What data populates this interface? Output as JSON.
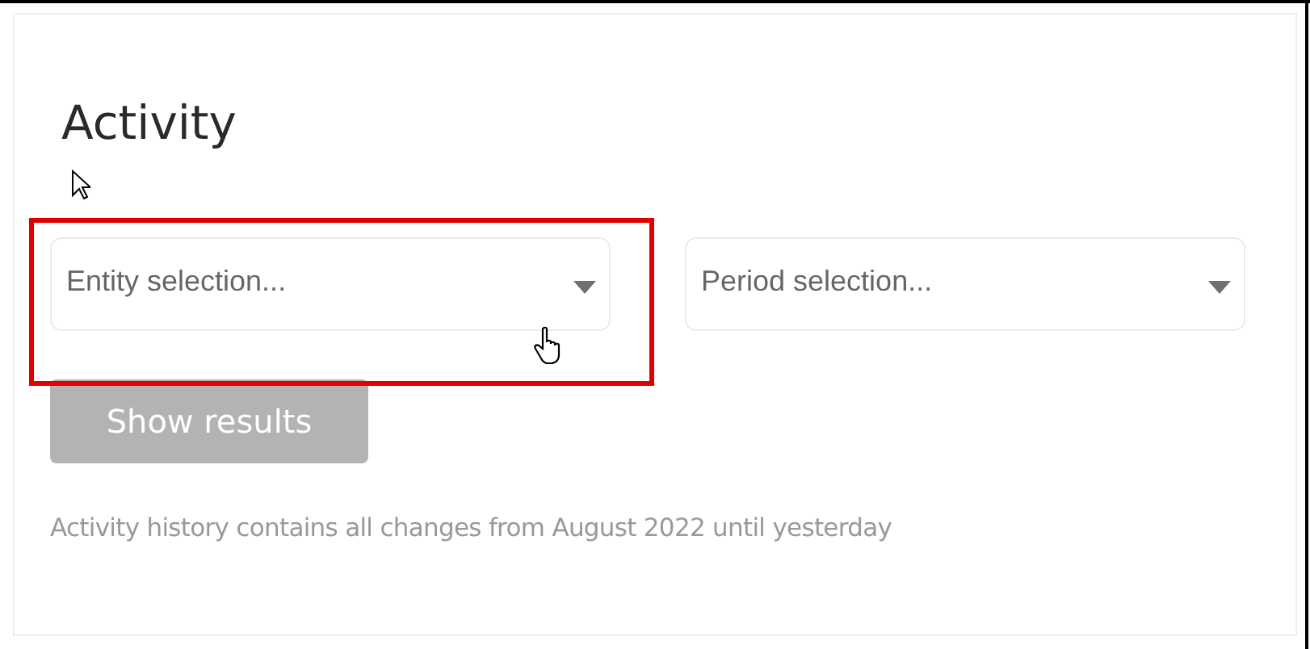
{
  "title": "Activity",
  "selects": [
    {
      "placeholder": "Entity selection...",
      "highlighted": true
    },
    {
      "placeholder": "Period selection...",
      "highlighted": false
    }
  ],
  "button": {
    "label": "Show results",
    "disabled": true
  },
  "note": "Activity history contains all changes from August 2022 until yesterday"
}
